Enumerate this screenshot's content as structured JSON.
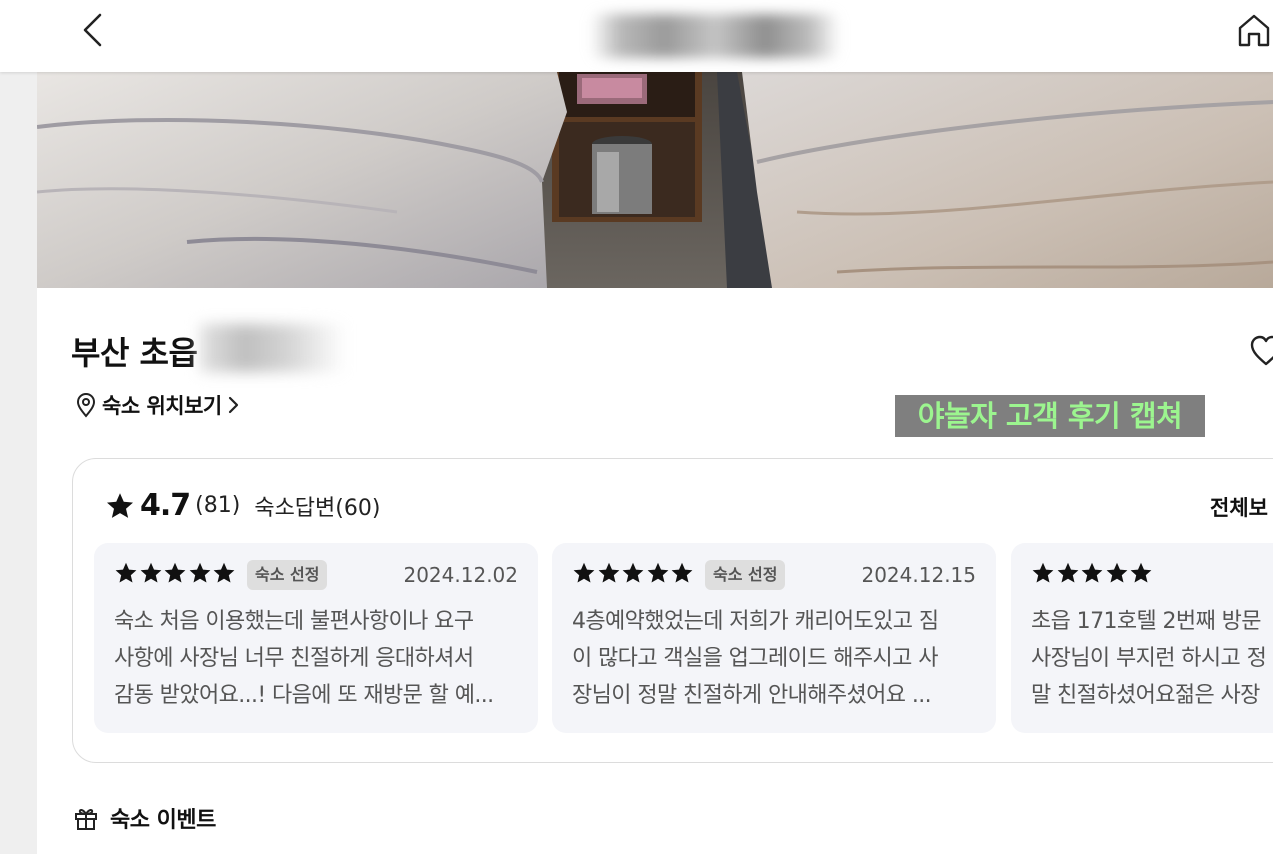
{
  "header": {
    "back_icon": "chevron-left-icon",
    "home_icon": "home-icon"
  },
  "hotel": {
    "name_visible": "부산 초읍",
    "location_link": "숙소 위치보기",
    "location_icon": "map-pin-icon"
  },
  "caption": {
    "text": "야놀자 고객 후기 캡쳐",
    "bg_color": "#7f7f7f",
    "text_color": "#9cf58f"
  },
  "reviews_summary": {
    "rating": "4.7",
    "count": "(81)",
    "host_replies": "숙소답변(60)",
    "view_all": "전체보"
  },
  "reviews": [
    {
      "stars": 5,
      "badge": "숙소 선정",
      "date": "2024.12.02",
      "lines": [
        "숙소 처음 이용했는데 불편사항이나 요구",
        "사항에 사장님 너무 친절하게 응대하셔서",
        "감동 받았어요...! 다음에 또 재방문 할 예..."
      ]
    },
    {
      "stars": 5,
      "badge": "숙소 선정",
      "date": "2024.12.15",
      "lines": [
        "4층예약했었는데 저희가 캐리어도있고 짐",
        "이 많다고 객실을 업그레이드 해주시고 사",
        "장님이 정말 친절하게 안내해주셨어요 ..."
      ]
    },
    {
      "stars": 5,
      "badge": "",
      "date": "",
      "lines": [
        "초읍 171호텔 2번째 방문",
        "사장님이 부지런 하시고 정",
        "말 친절하셨어요젊은 사장"
      ]
    }
  ],
  "event": {
    "label": "숙소 이벤트",
    "icon": "gift-icon"
  }
}
